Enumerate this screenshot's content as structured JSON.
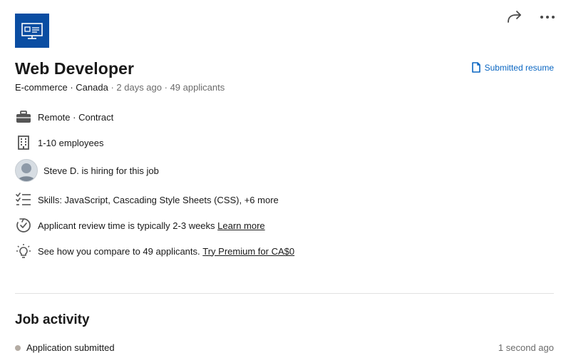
{
  "job": {
    "title": "Web Developer",
    "company": "E-commerce",
    "location": "Canada",
    "posted": "2 days ago",
    "applicants": "49 applicants",
    "submitted_label": "Submitted resume"
  },
  "features": {
    "workplace": "Remote · Contract",
    "company_size": "1-10 employees",
    "hiring": "Steve D. is hiring for this job",
    "skills": "Skills: JavaScript, Cascading Style Sheets (CSS), +6 more",
    "review_text": "Applicant review time is typically 2-3 weeks",
    "review_link": "Learn more",
    "compare_text": "See how you compare to 49 applicants.",
    "compare_link": "Try Premium for CA$0"
  },
  "activity": {
    "title": "Job activity",
    "items": [
      {
        "label": "Application submitted",
        "time": "1 second ago"
      }
    ]
  },
  "icons": {
    "logo": "monitor-icon",
    "share": "share-icon",
    "more": "more-icon",
    "document": "document-icon",
    "briefcase": "briefcase-icon",
    "building": "building-icon",
    "skills": "checklist-icon",
    "review": "clock-check-icon",
    "premium": "lightbulb-icon"
  },
  "colors": {
    "logo_bg": "#0a4da2",
    "link": "#0a66c2",
    "muted": "#6b6b6b"
  }
}
